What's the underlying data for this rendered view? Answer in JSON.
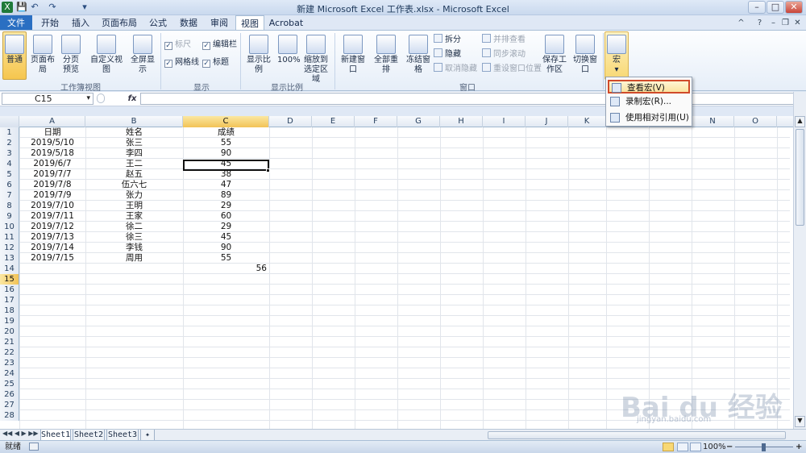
{
  "window": {
    "title": "新建 Microsoft Excel 工作表.xlsx - Microsoft Excel",
    "min": "–",
    "max": "□",
    "close": "✕"
  },
  "quick_access": [
    "💾",
    "↶",
    "↷",
    "▾"
  ],
  "tabs": [
    "文件",
    "开始",
    "插入",
    "页面布局",
    "公式",
    "数据",
    "审阅",
    "视图",
    "Acrobat"
  ],
  "ribbon": {
    "workbook_views": {
      "normal": "普通",
      "page_layout": "页面布局",
      "page_break": "分页预览",
      "custom": "自定义视图",
      "fullscreen": "全屏显示",
      "group": "工作簿视图"
    },
    "show": {
      "ruler": "标尺",
      "formula_bar": "编辑栏",
      "gridlines": "网格线",
      "headings": "标题",
      "group": "显示"
    },
    "zoom": {
      "zoom": "显示比例",
      "hundred": "100%",
      "to_selection": "缩放到选定区域",
      "group": "显示比例"
    },
    "window": {
      "new_window": "新建窗口",
      "arrange_all": "全部重排",
      "freeze": "冻结窗格",
      "split": "拆分",
      "hide": "隐藏",
      "unhide": "取消隐藏",
      "side_by_side": "并排查看",
      "sync_scroll": "同步滚动",
      "reset_pos": "重设窗口位置",
      "save_workspace": "保存工作区",
      "switch_windows": "切换窗口",
      "group": "窗口"
    },
    "macros": {
      "label": "宏"
    }
  },
  "formula_bar": {
    "name_box": "C15",
    "fx": "fx",
    "value": ""
  },
  "columns": [
    "A",
    "B",
    "C",
    "D",
    "E",
    "F",
    "G",
    "H",
    "I",
    "J",
    "K",
    "L",
    "M",
    "N",
    "O"
  ],
  "rows": [
    {
      "n": "1",
      "a": "日期",
      "b": "姓名",
      "c": "成绩"
    },
    {
      "n": "2",
      "a": "2019/5/10",
      "b": "张三",
      "c": "55"
    },
    {
      "n": "3",
      "a": "2019/5/18",
      "b": "李四",
      "c": "90"
    },
    {
      "n": "4",
      "a": "2019/6/7",
      "b": "王二",
      "c": "45"
    },
    {
      "n": "5",
      "a": "2019/7/7",
      "b": "赵五",
      "c": "38"
    },
    {
      "n": "6",
      "a": "2019/7/8",
      "b": "伍六七",
      "c": "47"
    },
    {
      "n": "7",
      "a": "2019/7/9",
      "b": "张力",
      "c": "89"
    },
    {
      "n": "8",
      "a": "2019/7/10",
      "b": "王明",
      "c": "29"
    },
    {
      "n": "9",
      "a": "2019/7/11",
      "b": "王家",
      "c": "60"
    },
    {
      "n": "10",
      "a": "2019/7/12",
      "b": "徐二",
      "c": "29"
    },
    {
      "n": "11",
      "a": "2019/7/13",
      "b": "徐三",
      "c": "45"
    },
    {
      "n": "12",
      "a": "2019/7/14",
      "b": "李钱",
      "c": "90"
    },
    {
      "n": "13",
      "a": "2019/7/15",
      "b": "周用",
      "c": "55"
    },
    {
      "n": "14",
      "a": "",
      "b": "",
      "c": "56"
    },
    {
      "n": "15",
      "a": "",
      "b": "",
      "c": ""
    },
    {
      "n": "16",
      "a": "",
      "b": "",
      "c": ""
    },
    {
      "n": "17",
      "a": "",
      "b": "",
      "c": ""
    },
    {
      "n": "18",
      "a": "",
      "b": "",
      "c": ""
    },
    {
      "n": "19",
      "a": "",
      "b": "",
      "c": ""
    },
    {
      "n": "20",
      "a": "",
      "b": "",
      "c": ""
    },
    {
      "n": "21",
      "a": "",
      "b": "",
      "c": ""
    },
    {
      "n": "22",
      "a": "",
      "b": "",
      "c": ""
    },
    {
      "n": "23",
      "a": "",
      "b": "",
      "c": ""
    },
    {
      "n": "24",
      "a": "",
      "b": "",
      "c": ""
    },
    {
      "n": "25",
      "a": "",
      "b": "",
      "c": ""
    },
    {
      "n": "26",
      "a": "",
      "b": "",
      "c": ""
    },
    {
      "n": "27",
      "a": "",
      "b": "",
      "c": ""
    },
    {
      "n": "28",
      "a": "",
      "b": "",
      "c": ""
    }
  ],
  "sheets": [
    "Sheet1",
    "Sheet2",
    "Sheet3"
  ],
  "status": {
    "ready": "就绪",
    "zoom": "100%",
    "minus": "−",
    "plus": "+"
  },
  "macro_menu": {
    "view": "查看宏(V)",
    "record": "录制宏(R)...",
    "relative": "使用相对引用(U)"
  },
  "watermark": {
    "brand": "Bai du 经验",
    "url": "jingyan.baidu.com"
  }
}
